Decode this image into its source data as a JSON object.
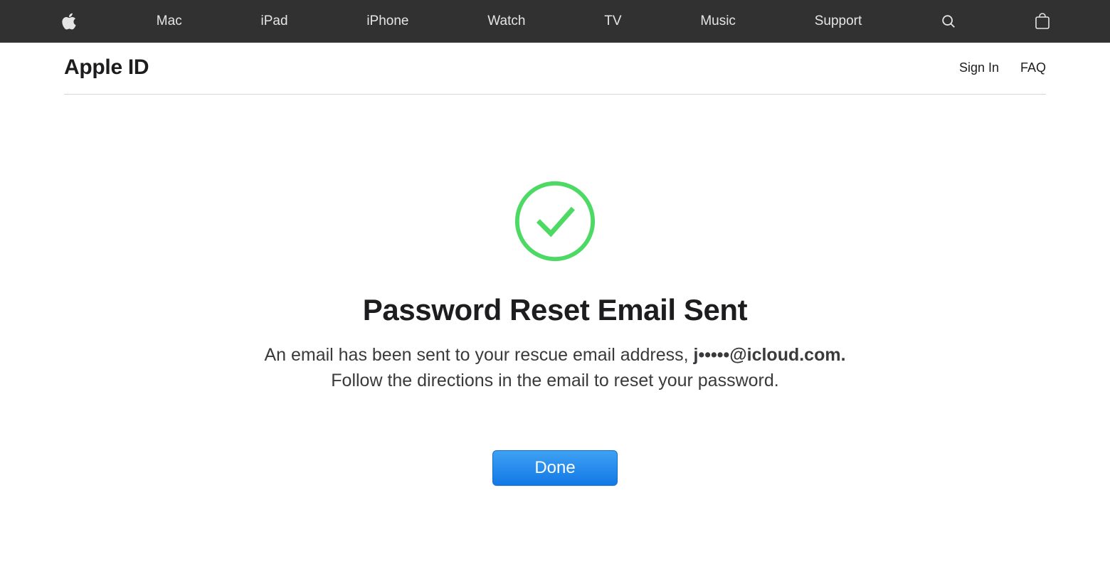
{
  "global_nav": {
    "items": [
      "Mac",
      "iPad",
      "iPhone",
      "Watch",
      "TV",
      "Music",
      "Support"
    ]
  },
  "local_nav": {
    "title": "Apple ID",
    "sign_in": "Sign In",
    "faq": "FAQ"
  },
  "content": {
    "headline": "Password Reset Email Sent",
    "body_prefix": "An email has been sent to your rescue email address, ",
    "masked_email": "j•••••@icloud.com.",
    "body_suffix": " Follow the directions in the email to reset your password.",
    "done_label": "Done"
  },
  "colors": {
    "nav_bg": "#313131",
    "accent_green": "#4cd964",
    "button_blue": "#1b86ec"
  }
}
